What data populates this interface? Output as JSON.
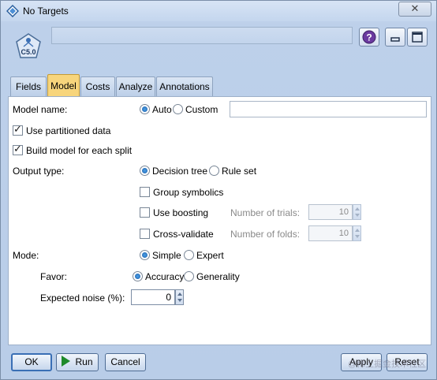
{
  "window": {
    "title": "No Targets",
    "close_symbol": "✕"
  },
  "node": {
    "icon_label": "C5.0",
    "name": ""
  },
  "header_buttons": {
    "help": "?",
    "minimize": "▭",
    "maximize": "▢"
  },
  "tabs": [
    {
      "label": "Fields",
      "active": false
    },
    {
      "label": "Model",
      "active": true
    },
    {
      "label": "Costs",
      "active": false
    },
    {
      "label": "Analyze",
      "active": false
    },
    {
      "label": "Annotations",
      "active": false
    }
  ],
  "form": {
    "model_name_label": "Model name:",
    "model_name_auto": "Auto",
    "model_name_custom": "Custom",
    "model_name_selected": "Auto",
    "model_name_value": "",
    "use_partitioned_label": "Use partitioned data",
    "use_partitioned_checked": true,
    "build_per_split_label": "Build model for each split",
    "build_per_split_checked": true,
    "output_type_label": "Output type:",
    "output_decision_tree": "Decision tree",
    "output_rule_set": "Rule set",
    "output_selected": "Decision tree",
    "group_symbolics_label": "Group symbolics",
    "group_symbolics_checked": false,
    "use_boosting_label": "Use boosting",
    "use_boosting_checked": false,
    "trials_label": "Number of trials:",
    "trials_value": "10",
    "cross_validate_label": "Cross-validate",
    "cross_validate_checked": false,
    "folds_label": "Number of folds:",
    "folds_value": "10",
    "mode_label": "Mode:",
    "mode_simple": "Simple",
    "mode_expert": "Expert",
    "mode_selected": "Simple",
    "favor_label": "Favor:",
    "favor_accuracy": "Accuracy",
    "favor_generality": "Generality",
    "favor_selected": "Accuracy",
    "noise_label": "Expected noise (%):",
    "noise_value": "0"
  },
  "buttons": {
    "ok": "OK",
    "run": "Run",
    "cancel": "Cancel",
    "apply": "Apply",
    "reset": "Reset"
  },
  "watermark": "@稀土掘金技术社区",
  "colors": {
    "active_tab": "#f7d57c",
    "window_bg": "#c4d6ee",
    "run_icon": "#1e8a2a"
  }
}
